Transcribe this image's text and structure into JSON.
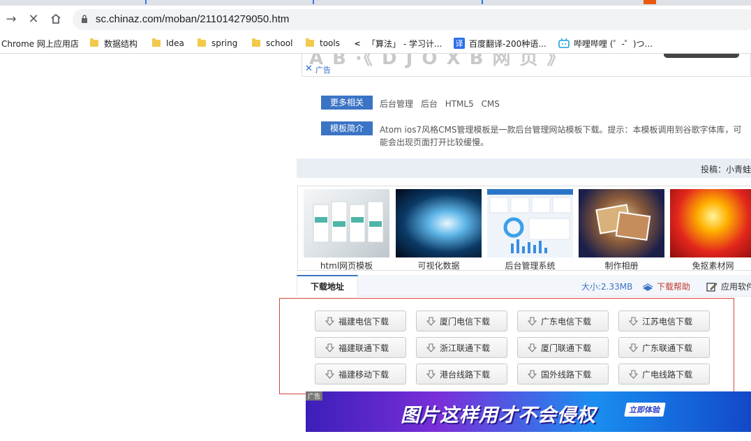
{
  "browser": {
    "url": "sc.chinaz.com/moban/211014279050.htm",
    "bookmarks": [
      {
        "label": "Chrome 网上应用店",
        "icon": "none"
      },
      {
        "label": "数据结构",
        "icon": "folder-icon"
      },
      {
        "label": "Idea",
        "icon": "folder-icon"
      },
      {
        "label": "spring",
        "icon": "folder-icon"
      },
      {
        "label": "school",
        "icon": "folder-icon"
      },
      {
        "label": "tools",
        "icon": "folder-icon"
      },
      {
        "label": "「算法」 - 学习计...",
        "icon": "leetcode-icon"
      },
      {
        "label": "百度翻译-200种语...",
        "icon": "translate-icon"
      },
      {
        "label": "哔哩哔哩 (゜-゜)つ...",
        "icon": "bilibili-icon"
      }
    ]
  },
  "ad_top": {
    "close": "✕",
    "tag": "广告"
  },
  "info": {
    "related_label": "更多相关",
    "related_tags": [
      "后台管理",
      "后台",
      "HTML5",
      "CMS"
    ],
    "intro_label": "模板简介",
    "intro_text": "Atom ios7风格CMS管理模板是一款后台管理网站模板下载。提示：本模板调用到谷歌字体库，可能会出现页面打开比较缓慢。",
    "submitter": "投稿：小青蛙"
  },
  "thumbs": [
    {
      "caption": "html网页模板"
    },
    {
      "caption": "可视化数据"
    },
    {
      "caption": "后台管理系统"
    },
    {
      "caption": "制作相册"
    },
    {
      "caption": "免抠素材网"
    }
  ],
  "download": {
    "tab_label": "下载地址",
    "size": "大小:2.33MB",
    "help": "下载帮助",
    "soft": "应用软件",
    "buttons": [
      "福建电信下载",
      "厦门电信下载",
      "广东电信下载",
      "江苏电信下载",
      "福建联通下载",
      "浙江联通下载",
      "厦门联通下载",
      "广东联通下载",
      "福建移动下载",
      "港台线路下载",
      "国外线路下载",
      "广电线路下载"
    ]
  },
  "ad_bottom": {
    "mark": "广告",
    "slogan": "图片这样用才不会侵权",
    "cta": "立即体验"
  },
  "colors": {
    "accent": "#3b74c5",
    "highlight_border": "#d9453b"
  }
}
